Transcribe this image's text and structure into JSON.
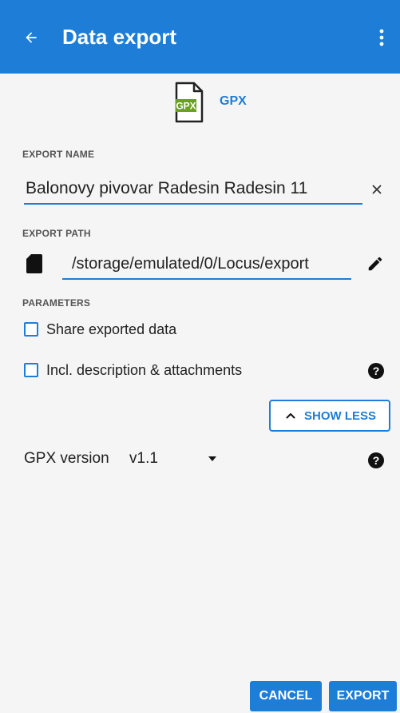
{
  "appbar": {
    "title": "Data export",
    "back_icon": "arrow-left-icon",
    "menu_icon": "more-vert-icon",
    "color": "#1e7dd7"
  },
  "format": {
    "file_icon_badge": "GPX",
    "label": "GPX",
    "badge_color": "#6aa121"
  },
  "export_name": {
    "section_label": "EXPORT NAME",
    "value": "Balonovy pivovar Radesin Radesin 11",
    "clear_icon": "close-icon"
  },
  "export_path": {
    "section_label": "EXPORT PATH",
    "storage_icon": "sd-card-icon",
    "value": "/storage/emulated/0/Locus/export",
    "edit_icon": "pencil-icon"
  },
  "parameters": {
    "section_label": "PARAMETERS",
    "options": [
      {
        "label": "Share exported data",
        "checked": false
      },
      {
        "label": "Incl. description & attachments",
        "checked": false,
        "help_icon": "help-circle-icon"
      }
    ],
    "show_less_label": "SHOW LESS",
    "show_less_icon": "chevron-up-icon"
  },
  "gpx_version": {
    "label": "GPX version",
    "selected": "v1.1",
    "help_icon": "help-circle-icon"
  },
  "actions": {
    "cancel_label": "CANCEL",
    "export_label": "EXPORT"
  },
  "colors": {
    "accent": "#1e7dd7",
    "background": "#f5f5f5"
  }
}
